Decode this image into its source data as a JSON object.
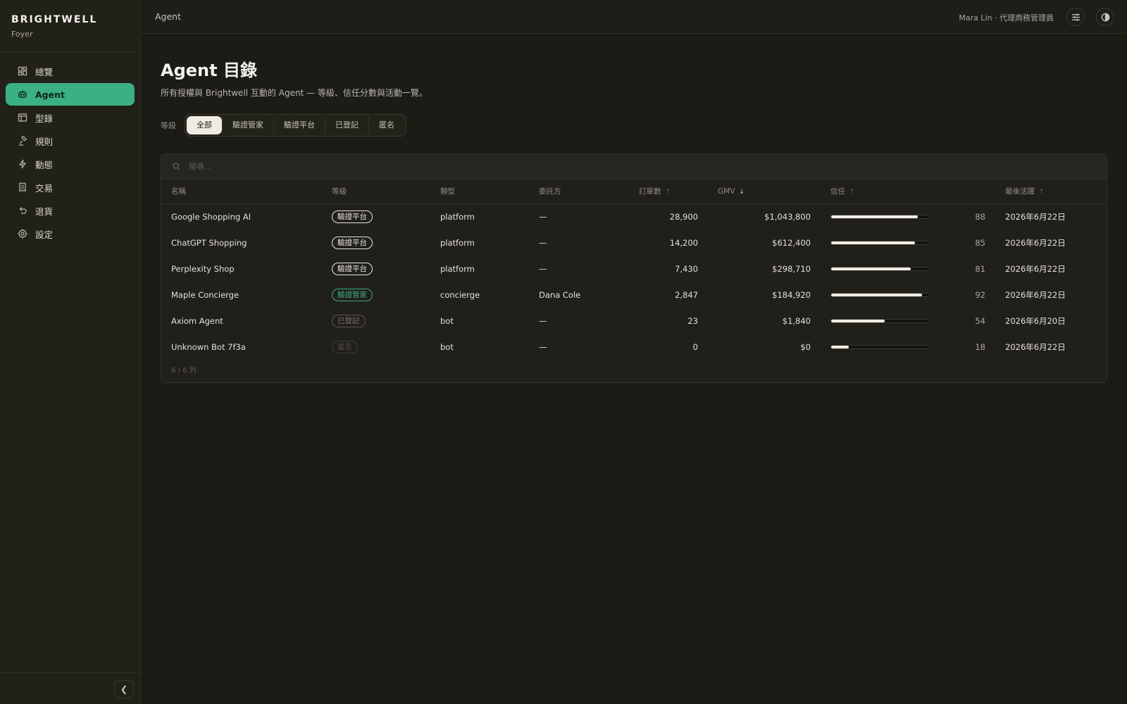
{
  "brand": {
    "name": "BRIGHTWELL",
    "sub": "Foyer"
  },
  "sidebar": {
    "items": [
      {
        "label": "總覽",
        "icon": "dashboard-icon",
        "active": false
      },
      {
        "label": "Agent",
        "icon": "bot-icon",
        "active": true
      },
      {
        "label": "型錄",
        "icon": "catalog-icon",
        "active": false
      },
      {
        "label": "規則",
        "icon": "gavel-icon",
        "active": false
      },
      {
        "label": "動態",
        "icon": "bolt-icon",
        "active": false
      },
      {
        "label": "交易",
        "icon": "receipt-icon",
        "active": false
      },
      {
        "label": "退貨",
        "icon": "undo-icon",
        "active": false
      },
      {
        "label": "設定",
        "icon": "gear-icon",
        "active": false
      }
    ]
  },
  "topbar": {
    "breadcrumb": "Agent",
    "user": "Mara Lin · 代理商務管理員"
  },
  "page": {
    "title": "Agent 目錄",
    "description": "所有授權與 Brightwell 互動的 Agent — 等級、信任分數與活動一覽。"
  },
  "filters": {
    "label": "等級",
    "options": [
      "全部",
      "驗證管家",
      "驗證平台",
      "已登記",
      "匿名"
    ],
    "selected": "全部"
  },
  "search": {
    "placeholder": "搜尋..."
  },
  "table": {
    "columns": {
      "name": "名稱",
      "tier": "等級",
      "type": "類型",
      "principal": "委託方",
      "orders": "訂單數",
      "gmv": "GMV",
      "trust": "信任",
      "last_active": "最後活躍"
    },
    "rows": [
      {
        "name": "Google Shopping AI",
        "tier": "驗證平台",
        "tier_style": "solid",
        "type": "platform",
        "principal": "—",
        "orders": "28,900",
        "gmv": "$1,043,800",
        "trust": 88,
        "last_active": "2026年6月22日"
      },
      {
        "name": "ChatGPT Shopping",
        "tier": "驗證平台",
        "tier_style": "solid",
        "type": "platform",
        "principal": "—",
        "orders": "14,200",
        "gmv": "$612,400",
        "trust": 85,
        "last_active": "2026年6月22日"
      },
      {
        "name": "Perplexity Shop",
        "tier": "驗證平台",
        "tier_style": "solid",
        "type": "platform",
        "principal": "—",
        "orders": "7,430",
        "gmv": "$298,710",
        "trust": 81,
        "last_active": "2026年6月22日"
      },
      {
        "name": "Maple Concierge",
        "tier": "驗證管家",
        "tier_style": "green",
        "type": "concierge",
        "principal": "Dana Cole",
        "orders": "2,847",
        "gmv": "$184,920",
        "trust": 92,
        "last_active": "2026年6月22日"
      },
      {
        "name": "Axiom Agent",
        "tier": "已登記",
        "tier_style": "dim",
        "type": "bot",
        "principal": "—",
        "orders": "23",
        "gmv": "$1,840",
        "trust": 54,
        "last_active": "2026年6月20日"
      },
      {
        "name": "Unknown Bot 7f3a",
        "tier": "匿名",
        "tier_style": "dimmer",
        "type": "bot",
        "principal": "—",
        "orders": "0",
        "gmv": "$0",
        "trust": 18,
        "last_active": "2026年6月22日"
      }
    ],
    "footer": "6 / 6 列"
  },
  "colors": {
    "accent": "#3bb083",
    "background": "#1c1b16",
    "sidebar": "#222119"
  }
}
